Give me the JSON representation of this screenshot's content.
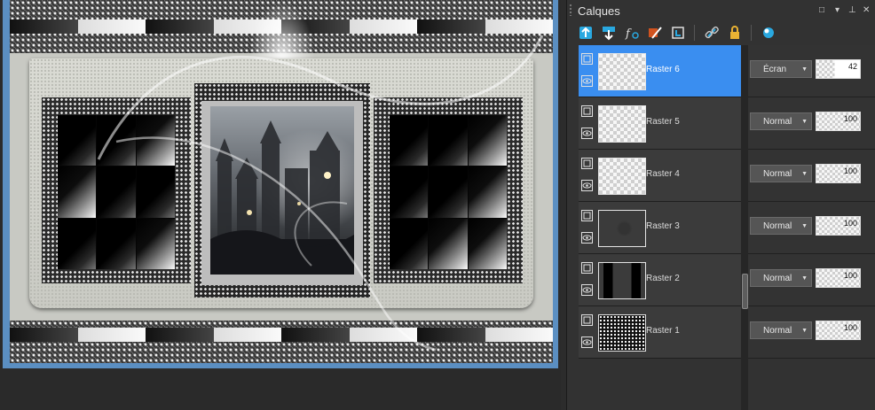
{
  "panel": {
    "title": "Calques",
    "window_controls": [
      "□",
      "▾",
      "⊥",
      "✕"
    ],
    "toolbar_icons": [
      "new-raster-layer-icon",
      "new-vector-layer-icon",
      "layer-effects-icon",
      "mask-icon",
      "group-icon",
      "link-icon",
      "lock-icon",
      "blend-range-icon"
    ]
  },
  "layers": [
    {
      "name": "Raster 6",
      "blend_mode": "Écran",
      "opacity": 42,
      "selected": true
    },
    {
      "name": "Raster 5",
      "blend_mode": "Normal",
      "opacity": 100,
      "selected": false
    },
    {
      "name": "Raster 4",
      "blend_mode": "Normal",
      "opacity": 100,
      "selected": false
    },
    {
      "name": "Raster 3",
      "blend_mode": "Normal",
      "opacity": 100,
      "selected": false
    },
    {
      "name": "Raster 2",
      "blend_mode": "Normal",
      "opacity": 100,
      "selected": false
    },
    {
      "name": "Raster 1",
      "blend_mode": "Normal",
      "opacity": 100,
      "selected": false
    }
  ],
  "colors": {
    "selection": "#3a8ef0",
    "panel_bg": "#323232",
    "canvas_border": "#5b8fc2"
  }
}
